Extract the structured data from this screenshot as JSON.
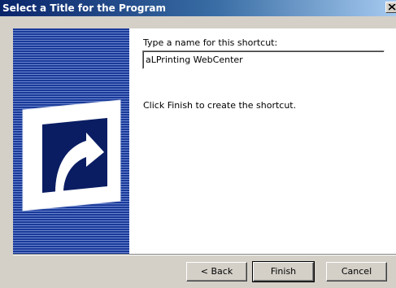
{
  "window": {
    "title": "Select a Title for the Program",
    "close_icon": "close-icon"
  },
  "banner": {
    "icon": "shortcut-arrow-icon",
    "colors": {
      "stripe_dark": "#1a3a99",
      "stripe_light": "#6b86cf"
    }
  },
  "content": {
    "prompt_label": "Type a name for this shortcut:",
    "name_value": "aLPrinting WebCenter",
    "finish_instruction": "Click Finish to create the shortcut."
  },
  "buttons": {
    "back_label": "< Back",
    "finish_label": "Finish",
    "cancel_label": "Cancel"
  },
  "colors": {
    "titlebar_start": "#0a246a",
    "titlebar_end": "#a6caf0",
    "dialog_face": "#d4d0c8"
  }
}
